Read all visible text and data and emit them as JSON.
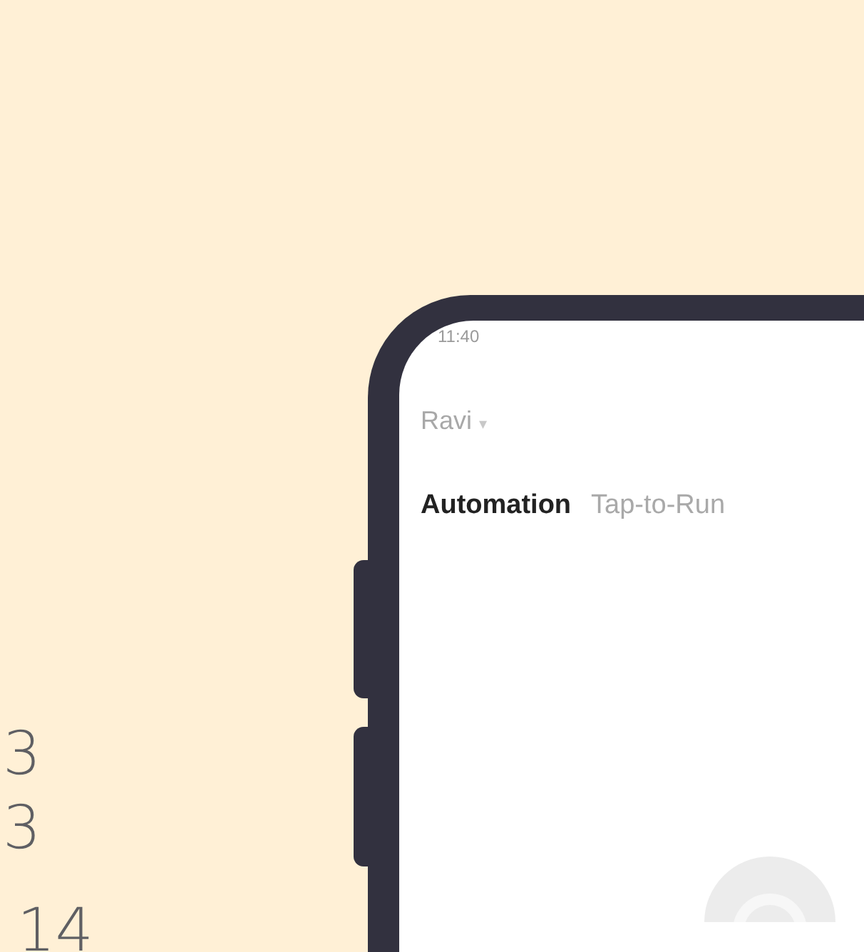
{
  "background_numbers": [
    "3",
    "3",
    "14"
  ],
  "phone": {
    "status_bar": {
      "time": "11:40"
    },
    "home_selector": {
      "label": "Ravi",
      "dropdown": "▾"
    },
    "tabs": [
      {
        "label": "Automation",
        "selected": true
      },
      {
        "label": "Tap-to-Run",
        "selected": false
      }
    ]
  }
}
